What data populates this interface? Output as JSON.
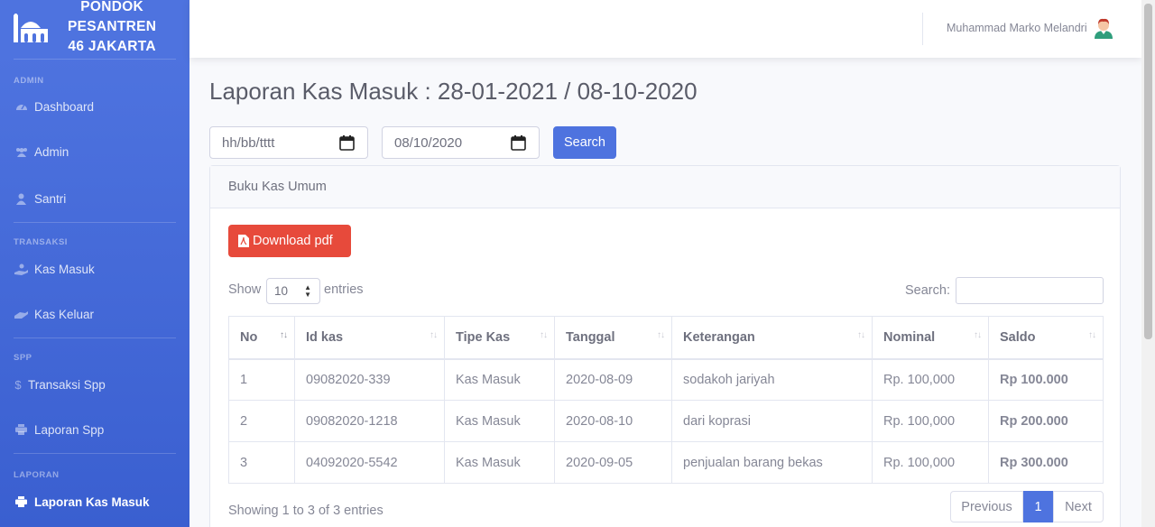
{
  "sidebar": {
    "brand": {
      "line1": "PONDOK",
      "line2": "PESANTREN",
      "line3": "46 JAKARTA",
      "icon": "mosque-icon"
    },
    "sections": [
      {
        "heading": "ADMIN"
      },
      {
        "heading": "TRANSAKSI"
      },
      {
        "heading": "SPP"
      },
      {
        "heading": "LAPORAN"
      }
    ],
    "items": [
      {
        "label": "Dashboard",
        "icon": "tachometer-icon"
      },
      {
        "label": "Admin",
        "icon": "users-icon"
      },
      {
        "label": "Santri",
        "icon": "user-icon"
      },
      {
        "label": "Kas Masuk",
        "icon": "hand-holding-icon"
      },
      {
        "label": "Kas Keluar",
        "icon": "hand-giving-icon"
      },
      {
        "label": "Transaksi Spp",
        "icon": "dollar-icon"
      },
      {
        "label": "Laporan Spp",
        "icon": "print-icon"
      },
      {
        "label": "Laporan Kas Masuk",
        "icon": "print-icon",
        "active": true
      }
    ]
  },
  "topbar": {
    "user_name": "Muhammad Marko Melandri"
  },
  "page": {
    "title": "Laporan Kas Masuk : 28-01-2021 / 08-10-2020",
    "date_from_placeholder": "hh/bb/tttt",
    "date_to_value": "08/10/2020",
    "search_button": "Search"
  },
  "card": {
    "header": "Buku Kas Umum",
    "download_button": "Download pdf",
    "show_label": "Show",
    "entries_value": "10",
    "entries_label": "entries",
    "search_label": "Search:",
    "columns": [
      "No",
      "Id kas",
      "Tipe Kas",
      "Tanggal",
      "Keterangan",
      "Nominal",
      "Saldo"
    ],
    "rows": [
      [
        "1",
        "09082020-339",
        "Kas Masuk",
        "2020-08-09",
        "sodakoh jariyah",
        "Rp. 100,000",
        "Rp 100.000"
      ],
      [
        "2",
        "09082020-1218",
        "Kas Masuk",
        "2020-08-10",
        "dari koprasi",
        "Rp. 100,000",
        "Rp 200.000"
      ],
      [
        "3",
        "04092020-5542",
        "Kas Masuk",
        "2020-09-05",
        "penjualan barang bekas",
        "Rp. 100,000",
        "Rp 300.000"
      ]
    ],
    "info": "Showing 1 to 3 of 3 entries",
    "pager": {
      "prev": "Previous",
      "current": "1",
      "next": "Next"
    }
  },
  "colors": {
    "primary": "#4e73df",
    "danger": "#e74a3b",
    "text": "#858796"
  }
}
